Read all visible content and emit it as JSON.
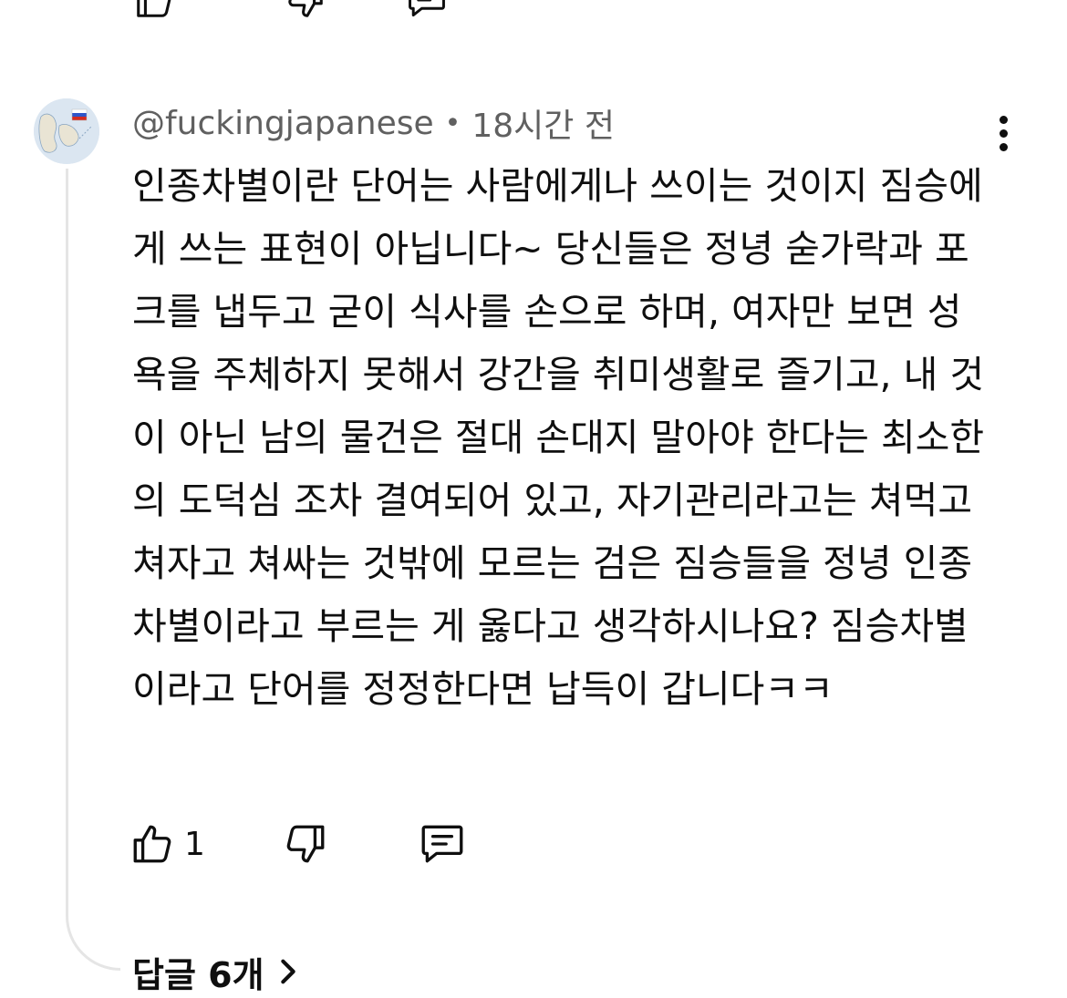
{
  "comment": {
    "author": "@fuckingjapanese",
    "separator": "•",
    "time_ago": "18시간 전",
    "text": "인종차별이란 단어는 사람에게나 쓰이는 것이지 짐승에게 쓰는 표현이 아닙니다~ 당신들은 정녕 숟가락과 포크를 냅두고 굳이 식사를 손으로 하며, 여자만 보면 성욕을 주체하지 못해서 강간을 취미생활로 즐기고, 내 것이 아닌 남의 물건은 절대 손대지 말아야 한다는 최소한의 도덕심 조차 결여되어 있고, 자기관리라고는 쳐먹고 쳐자고 쳐싸는 것밖에 모르는 검은 짐승들을 정녕 인종차별이라고 부르는 게 옳다고 생각하시나요? 짐승차별이라고 단어를 정정한다면 납득이 갑니다ㅋㅋ",
    "like_count": "1",
    "replies_label": "답글 6개"
  },
  "icons": {
    "like": "thumbs-up-icon",
    "dislike": "thumbs-down-icon",
    "reply": "comment-icon",
    "more": "more-vertical-icon",
    "expand": "chevron-right-icon"
  },
  "colors": {
    "text": "#0f0f0f",
    "meta": "#606060",
    "thread_line": "#e5e5e5"
  }
}
